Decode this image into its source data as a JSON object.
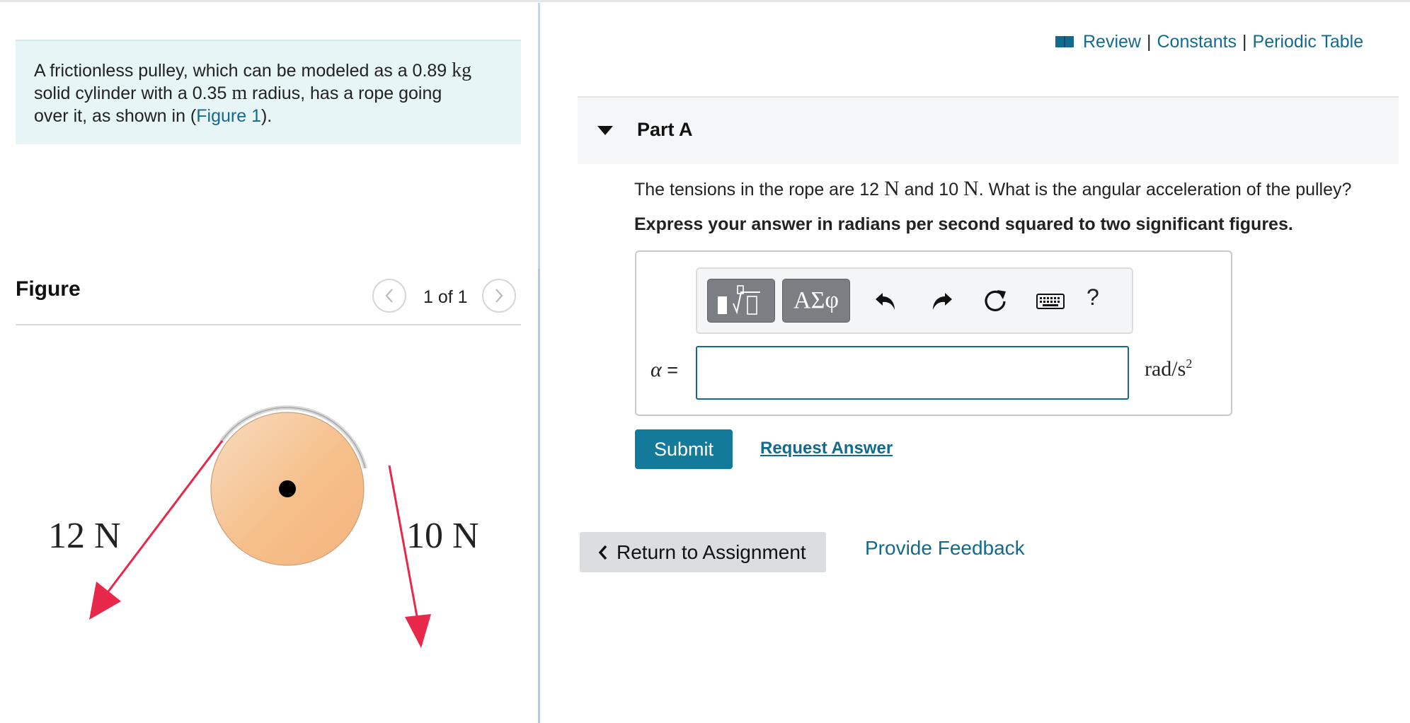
{
  "problem": {
    "text_1": "A frictionless pulley, which can be modeled as a 0.89 ",
    "unit_mass": "kg",
    "text_2": "solid cylinder with a 0.35 ",
    "unit_length": "m",
    "text_3": " radius, has a rope going",
    "text_4": "over it, as shown in (",
    "figure_link": "Figure 1",
    "text_5": ")."
  },
  "figure": {
    "title": "Figure",
    "page_indicator": "1 of 1",
    "label_left": "12 N",
    "label_right": "10 N",
    "pulley_color": "#f4c28e",
    "arrow_color": "#e8284a"
  },
  "top_links": {
    "review": "Review",
    "separator": "|",
    "constants": "Constants",
    "periodic_table": "Periodic Table"
  },
  "part": {
    "title": "Part A",
    "question_1": "The tensions in the rope are 12 ",
    "unit_n1": "N",
    "question_2": " and 10 ",
    "unit_n2": "N",
    "question_3": ". What is the angular acceleration of the pulley?",
    "instruction": "Express your answer in radians per second squared to two significant figures."
  },
  "answer": {
    "toolbar_symbols": "ΑΣφ",
    "help": "?",
    "variable": "α",
    "equals": " =",
    "input_value": "",
    "unit_base": "rad/s",
    "unit_exp": "2"
  },
  "actions": {
    "submit": "Submit",
    "request_answer": "Request Answer",
    "return": "Return to Assignment",
    "feedback": "Provide Feedback"
  }
}
